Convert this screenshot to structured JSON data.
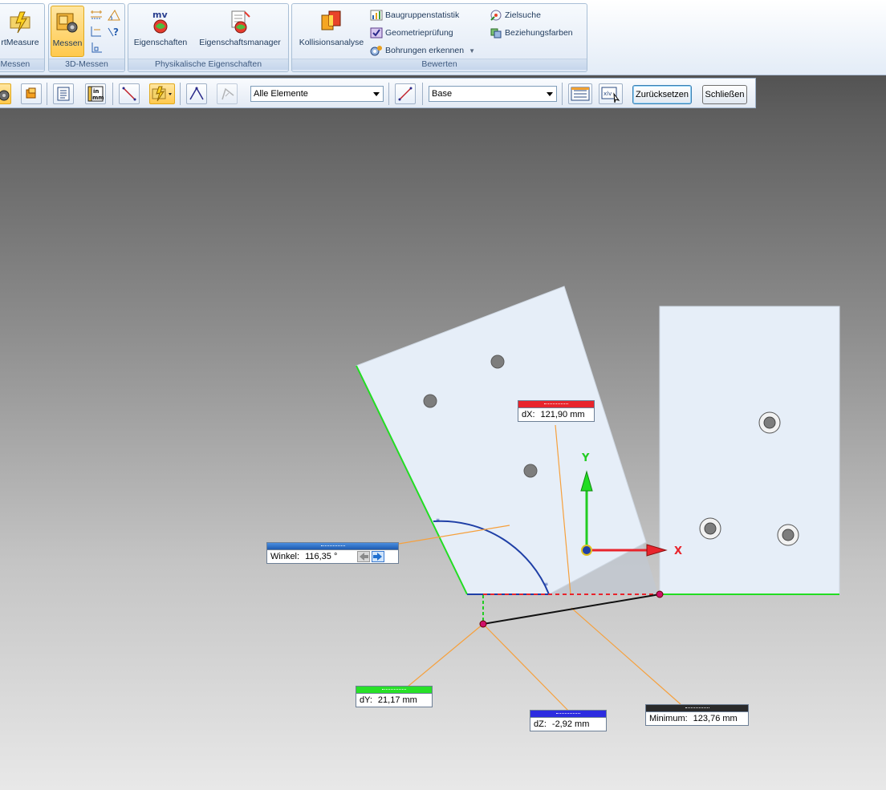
{
  "ribbon": {
    "groups": [
      {
        "label": "-Messen",
        "buttons": [
          {
            "label": "rtMeasure",
            "icon": "smartmeasure-icon"
          }
        ]
      },
      {
        "label": "3D-Messen",
        "buttons": [
          {
            "label": "Messen",
            "icon": "measure-icon",
            "active": true
          }
        ]
      },
      {
        "label": "Physikalische Eigenschaften",
        "buttons": [
          {
            "label": "Eigenschaften",
            "icon": "physical-properties-icon"
          },
          {
            "label": "Eigenschaftsmanager",
            "icon": "properties-manager-icon"
          }
        ]
      },
      {
        "label": "Bewerten",
        "buttons": [
          {
            "label": "Kollisionsanalyse",
            "icon": "interference-icon"
          },
          {
            "label": "Baugruppenstatistik",
            "icon": "assembly-statistics-icon"
          },
          {
            "label": "Geometrieprüfung",
            "icon": "geometry-check-icon"
          },
          {
            "label": "Bohrungen erkennen",
            "icon": "hole-recognition-icon"
          },
          {
            "label": "Zielsuche",
            "icon": "goal-seek-icon"
          },
          {
            "label": "Beziehungsfarben",
            "icon": "relationship-colors-icon"
          }
        ]
      }
    ],
    "mv_badge": "mv"
  },
  "cmdbar": {
    "filter_value": "Alle Elemente",
    "coordinate_value": "Base",
    "reset_label": "Zurücksetzen",
    "close_label": "Schließen",
    "units_icon_text": "in\nmm"
  },
  "viewport": {
    "axis_labels": {
      "x": "X",
      "y": "Y"
    },
    "angle": {
      "label": "Winkel:",
      "value": "116,35 °"
    },
    "dx": {
      "label": "dX:",
      "value": "121,90 mm"
    },
    "dy": {
      "label": "dY:",
      "value": "21,17 mm"
    },
    "dz": {
      "label": "dZ:",
      "value": "-2,92 mm"
    },
    "minimum": {
      "label": "Minimum:",
      "value": "123,76 mm"
    }
  },
  "colors": {
    "dx_header": "#e8242c",
    "dy_header": "#28e028",
    "dz_header": "#2c2ce0",
    "min_header": "#2a2a2a",
    "angle_header": "#2a70c8",
    "part_fill": "#e6eef8",
    "edge_green": "#22dd22",
    "leader_orange": "#f6a03c"
  }
}
